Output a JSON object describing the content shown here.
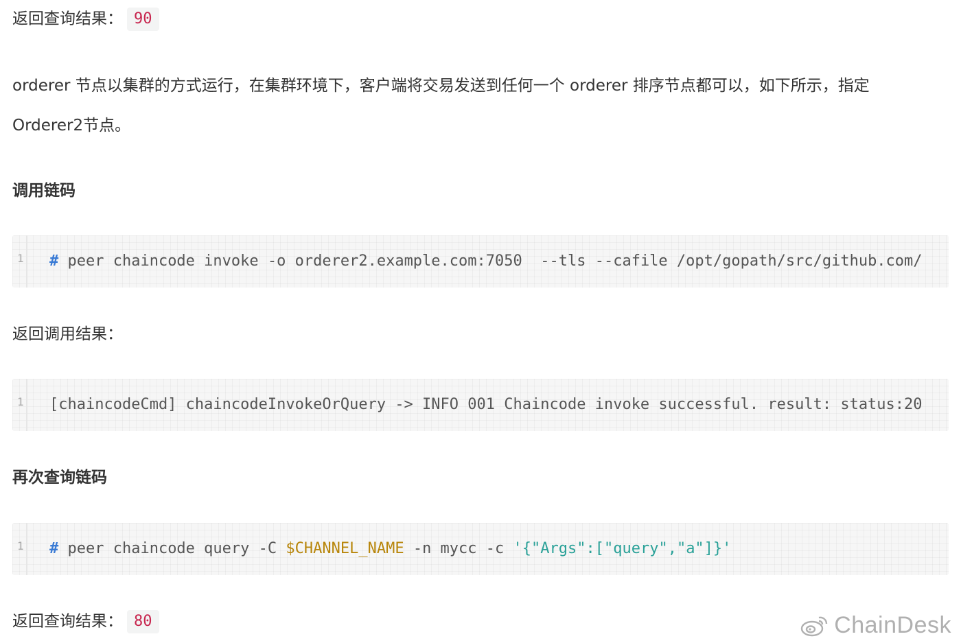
{
  "blocks": {
    "query_result_1": {
      "label": "返回查询结果：",
      "value": "90"
    },
    "orderer_paragraph": {
      "line1": "orderer 节点以集群的方式运行，在集群环境下，客户端将交易发送到任何一个 orderer 排序节点都可以，如下所示，指定",
      "line2": "Orderer2节点。"
    },
    "invoke_heading": "调用链码",
    "invoke_code": {
      "line_number": "1",
      "comment": "#",
      "text": " peer chaincode invoke -o orderer2.example.com:7050  --tls --cafile /opt/gopath/src/github.com/"
    },
    "invoke_result_label": "返回调用结果：",
    "invoke_result_code": {
      "line_number": "1",
      "text": "[chaincodeCmd] chaincodeInvokeOrQuery -> INFO 001 Chaincode invoke successful. result: status:20"
    },
    "requery_heading": "再次查询链码",
    "query_code": {
      "line_number": "1",
      "comment": "#",
      "part1": " peer chaincode query -C ",
      "variable": "$CHANNEL_NAME",
      "part2": " -n mycc -c ",
      "string": "'{\"Args\":[\"query\",\"a\"]}'"
    },
    "query_result_2": {
      "label": "返回查询结果：",
      "value": "80"
    }
  },
  "watermark": {
    "text": "ChainDesk",
    "icon": "weibo-icon"
  },
  "colors": {
    "inline_code": "#c7254e",
    "comment": "#3a7bd5",
    "variable": "#b8860b",
    "string": "#2aa198"
  }
}
